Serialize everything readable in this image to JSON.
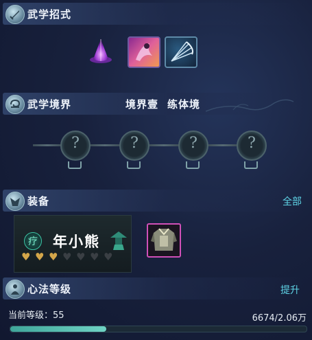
{
  "sections": {
    "moves": {
      "title": "武学招式"
    },
    "realm": {
      "title": "武学境界",
      "realm_name": "境界壹",
      "realm_stage": "练体境"
    },
    "equipment": {
      "title": "装备",
      "all_link": "全部"
    },
    "heart_method": {
      "title": "心法等级",
      "upgrade_link": "提升"
    }
  },
  "skills": [
    {
      "icon": "purple-crystal-cone-icon"
    },
    {
      "icon": "dancer-skill-icon"
    },
    {
      "icon": "fan-skill-icon"
    }
  ],
  "realm_nodes": [
    {
      "glyph": "?",
      "locked": true
    },
    {
      "glyph": "?",
      "locked": true
    },
    {
      "glyph": "?",
      "locked": true
    },
    {
      "glyph": "?",
      "locked": true
    }
  ],
  "character_card": {
    "badge_glyph": "疗",
    "name": "年小熊",
    "hearts_filled": 3,
    "hearts_total": 7,
    "colors": {
      "heart_filled": "#d4a64a",
      "heart_empty": "#3a3f44",
      "badge": "#3cc6a6"
    }
  },
  "equipment_item": {
    "icon": "armor-chestplate-icon",
    "border_color": "#d050b8"
  },
  "level": {
    "label": "当前等级：",
    "value": "55",
    "exp_text": "6674/2.06万",
    "progress_fraction": 0.324
  },
  "colors": {
    "accent": "#5fd4e6",
    "background": "#18213d"
  }
}
